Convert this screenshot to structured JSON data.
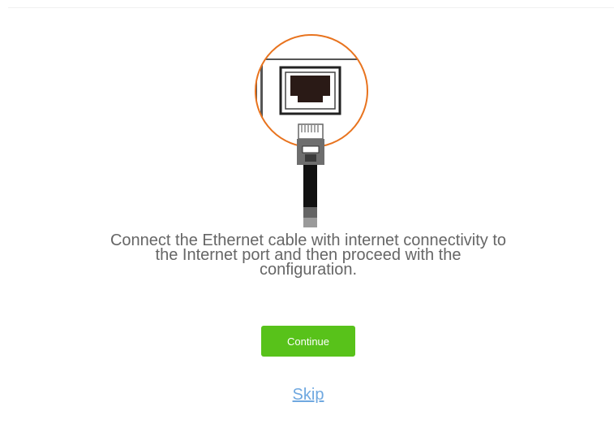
{
  "instruction": {
    "line1": "Connect the Ethernet cable with internet connectivity to",
    "line2": "the Internet port and then proceed with the",
    "line3": "configuration."
  },
  "buttons": {
    "continue_label": "Continue",
    "skip_label": "Skip"
  },
  "illustration": {
    "icon": "ethernet-port-with-cable-icon",
    "highlight_color": "#e8731e",
    "port_color": "#2a1a16"
  },
  "colors": {
    "accent": "#58c21a",
    "link": "#6fa8e0",
    "text": "#666666"
  }
}
